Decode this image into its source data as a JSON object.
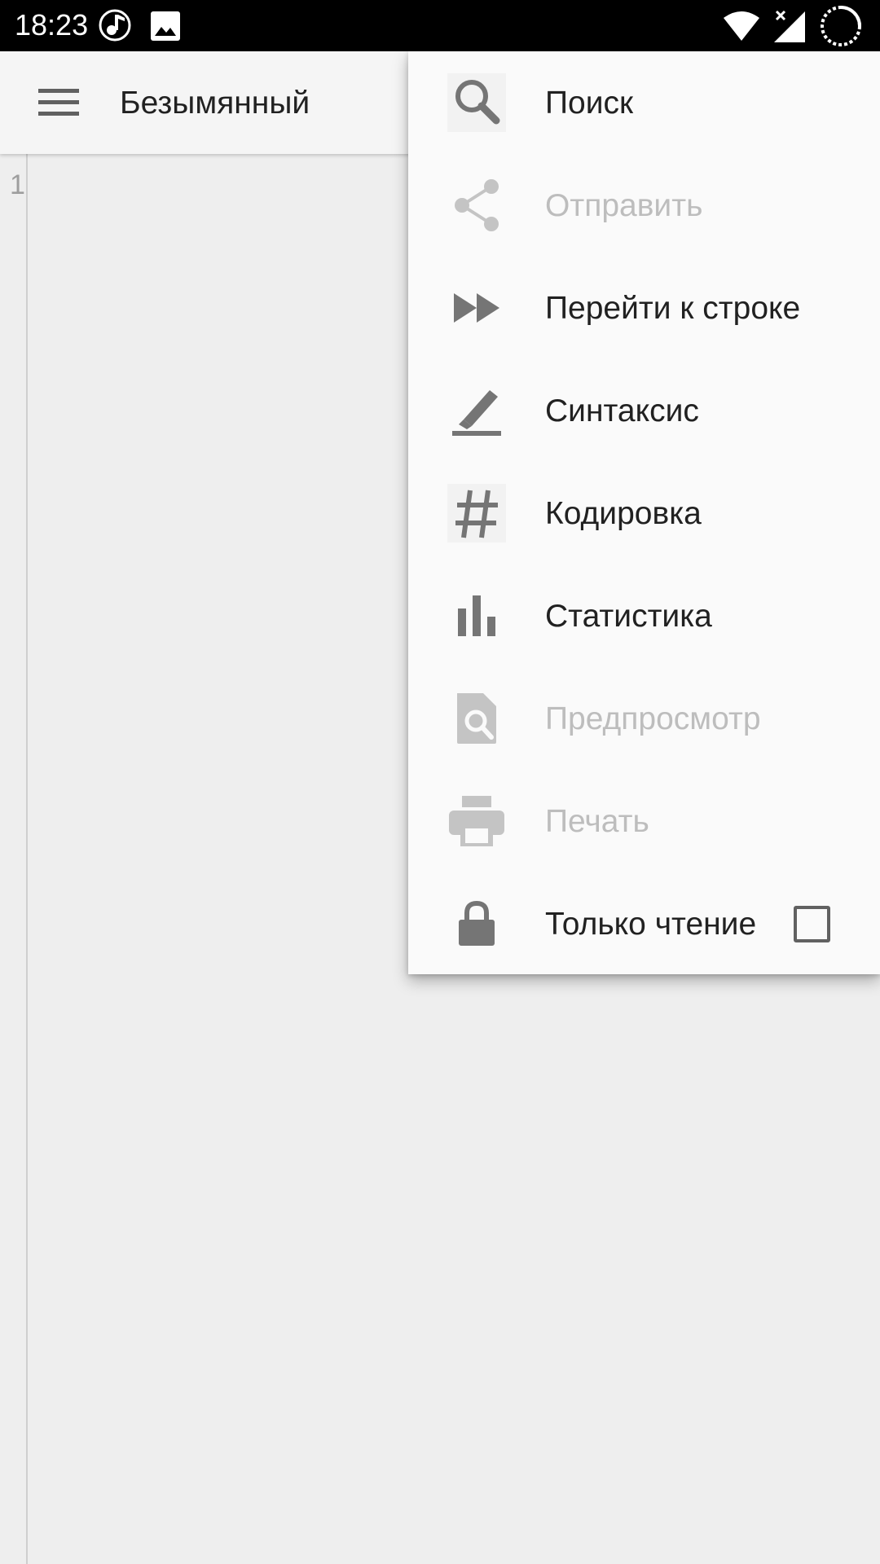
{
  "status_bar": {
    "time": "18:23",
    "icons": [
      "music-note-icon",
      "image-icon",
      "wifi-icon",
      "signal-icon",
      "sync-progress-icon"
    ]
  },
  "app_bar": {
    "title": "Безымянный",
    "menu_icon": "hamburger-menu-icon"
  },
  "editor": {
    "line_numbers": [
      "1"
    ]
  },
  "overflow_menu": {
    "items": [
      {
        "label": "Поиск",
        "icon": "search-icon",
        "enabled": true
      },
      {
        "label": "Отправить",
        "icon": "share-icon",
        "enabled": false
      },
      {
        "label": "Перейти к строке",
        "icon": "fast-forward-icon",
        "enabled": true
      },
      {
        "label": "Синтаксис",
        "icon": "highlight-pen-icon",
        "enabled": true
      },
      {
        "label": "Кодировка",
        "icon": "hash-icon",
        "enabled": true
      },
      {
        "label": "Статистика",
        "icon": "bar-chart-icon",
        "enabled": true
      },
      {
        "label": "Предпросмотр",
        "icon": "preview-icon",
        "enabled": false
      },
      {
        "label": "Печать",
        "icon": "print-icon",
        "enabled": false
      },
      {
        "label": "Только чтение",
        "icon": "lock-icon",
        "enabled": true,
        "checked": false
      }
    ]
  },
  "colors": {
    "status_bar": "#000000",
    "app_bar": "#f5f5f5",
    "editor_bg": "#eeeeee",
    "menu_bg": "#fafafa",
    "icon_enabled": "#757575",
    "icon_disabled": "#c4c4c4",
    "text_enabled": "#212121",
    "text_disabled": "#bdbdbd"
  }
}
